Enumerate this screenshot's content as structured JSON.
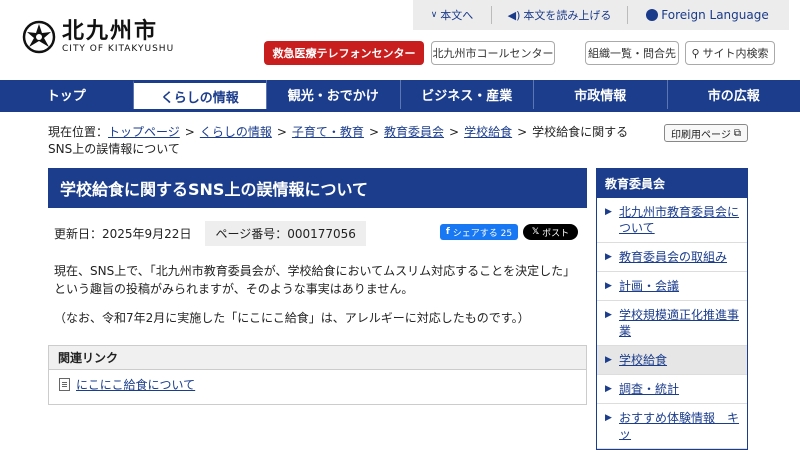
{
  "header": {
    "logo_jp": "北九州市",
    "logo_en": "CITY OF KITAKYUSHU",
    "util": {
      "skip": "本文へ",
      "read": "本文を読み上げる",
      "lang": "Foreign Language"
    },
    "emergency": "救急医療テレフォンセンター",
    "callcenter": "北九州市コールセンター",
    "orgs": "組織一覧・問合先",
    "search": "サイト内検索"
  },
  "nav": [
    {
      "label": "トップ"
    },
    {
      "label": "くらしの情報",
      "active": true
    },
    {
      "label": "観光・おでかけ"
    },
    {
      "label": "ビジネス・産業"
    },
    {
      "label": "市政情報"
    },
    {
      "label": "市の広報"
    }
  ],
  "breadcrumb": {
    "prefix": "現在位置：",
    "links": [
      "トップページ",
      "くらしの情報",
      "子育て・教育",
      "教育委員会",
      "学校給食"
    ],
    "current": "学校給食に関するSNS上の誤情報について",
    "separator": ">"
  },
  "print_label": "印刷用ページ",
  "article": {
    "title": "学校給食に関するSNS上の誤情報について",
    "updated": "更新日：2025年9月22日",
    "page_number": "ページ番号：000177056",
    "share_fb": "シェアする 25",
    "share_x": "ポスト",
    "paragraph1": "現在、SNS上で、「北九州市教育委員会が、学校給食においてムスリム対応することを決定した」という趣旨の投稿がみられますが、そのような事実はありません。",
    "paragraph2": "（なお、令和7年2月に実施した「にこにこ給食」は、アレルギーに対応したものです。）"
  },
  "related": {
    "heading": "関連リンク",
    "link": "にこにこ給食について"
  },
  "sidebar": {
    "heading": "教育委員会",
    "items": [
      {
        "label": "北九州市教育委員会について"
      },
      {
        "label": "教育委員会の取組み"
      },
      {
        "label": "計画・会議"
      },
      {
        "label": "学校規模適正化推進事業"
      },
      {
        "label": "学校給食",
        "current": true
      },
      {
        "label": "調査・統計"
      },
      {
        "label": "おすすめ体験情報　キッ"
      }
    ]
  },
  "colors": {
    "brand": "#1b3d8c",
    "emergency": "#c81e1e"
  }
}
